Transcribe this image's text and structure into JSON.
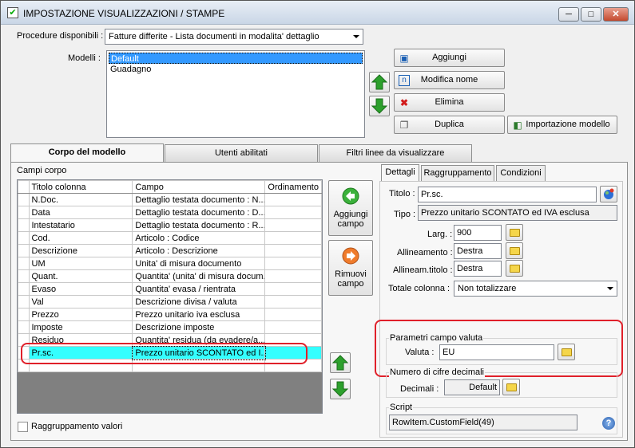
{
  "window": {
    "title": "IMPOSTAZIONE VISUALIZZAZIONI / STAMPE",
    "controls": {
      "minimize": "─",
      "maximize": "□",
      "close": "✕"
    }
  },
  "procedure": {
    "label": "Procedure disponibili :",
    "value": "Fatture differite - Lista documenti in modalita' dettaglio"
  },
  "modelli": {
    "label": "Modelli :",
    "items": [
      "Default",
      "Guadagno"
    ],
    "selected": "Default"
  },
  "buttons": {
    "aggiungi": "Aggiungi",
    "modifica_nome": "Modifica nome",
    "elimina": "Elimina",
    "duplica": "Duplica",
    "importazione": "Importazione modello"
  },
  "tabs": [
    "Corpo del modello",
    "Utenti abilitati",
    "Filtri linee da visualizzare"
  ],
  "campi_corpo": {
    "label": "Campi corpo",
    "columns": [
      "Titolo colonna",
      "Campo",
      "Ordinamento"
    ],
    "rows": [
      [
        "N.Doc.",
        "Dettaglio testata documento : N..."
      ],
      [
        "Data",
        "Dettaglio testata documento : D..."
      ],
      [
        "Intestatario",
        "Dettaglio testata documento : R..."
      ],
      [
        "Cod.",
        "Articolo : Codice"
      ],
      [
        "Descrizione",
        "Articolo : Descrizione"
      ],
      [
        "UM",
        "Unita' di misura documento"
      ],
      [
        "Quant.",
        "Quantita' (unita' di misura docum..."
      ],
      [
        "Evaso",
        "Quantita' evasa / rientrata"
      ],
      [
        "Val",
        "Descrizione divisa / valuta"
      ],
      [
        "Prezzo",
        "Prezzo unitario iva esclusa"
      ],
      [
        "Imposte",
        "Descrizione imposte"
      ],
      [
        "Residuo",
        "Quantita' residua (da evadere/a..."
      ],
      [
        "Pr.sc.",
        "Prezzo unitario SCONTATO ed I..."
      ]
    ],
    "selected_row": 12
  },
  "side_buttons": {
    "aggiungi_campo": "Aggiungi campo",
    "rimuovi_campo": "Rimuovi campo"
  },
  "raggruppamento": {
    "label": "Raggruppamento valori",
    "checked": false
  },
  "subtabs": [
    "Dettagli",
    "Raggruppamento",
    "Condizioni"
  ],
  "dettagli": {
    "titolo_label": "Titolo :",
    "titolo_value": "Pr.sc.",
    "tipo_label": "Tipo :",
    "tipo_value": "Prezzo unitario SCONTATO ed IVA esclusa",
    "larg_label": "Larg. :",
    "larg_value": "900",
    "allineamento_label": "Allineamento :",
    "allineamento_value": "Destra",
    "allineam_titolo_label": "Allineam.titolo :",
    "allineam_titolo_value": "Destra",
    "totale_label": "Totale colonna :",
    "totale_value": "Non totalizzare",
    "valuta_group": "Parametri campo valuta",
    "valuta_label": "Valuta :",
    "valuta_value": "EU",
    "decimali_group": "Numero di cifre decimali",
    "decimali_label": "Decimali :",
    "decimali_value": "Default",
    "script_group": "Script",
    "script_value": "RowItem.CustomField(49)"
  },
  "colors": {
    "selection": "#33ffff",
    "highlight": "#e0202a",
    "list_select": "#3399ff"
  }
}
